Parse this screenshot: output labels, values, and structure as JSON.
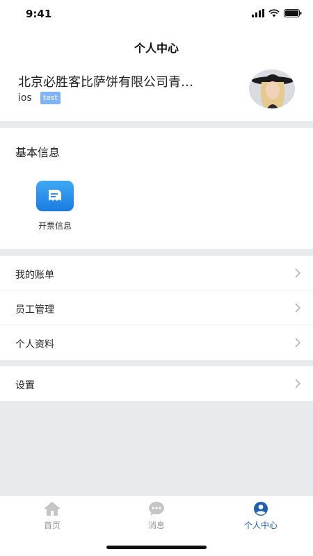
{
  "status_bar": {
    "time": "9:41"
  },
  "header": {
    "title": "个人中心"
  },
  "profile": {
    "company": "北京必胜客比萨饼有限公司青…",
    "username": "ios",
    "tag": "test"
  },
  "basic_info": {
    "title": "基本信息",
    "items": [
      {
        "label": "开票信息",
        "icon": "invoice-icon"
      }
    ]
  },
  "menu": {
    "group1": [
      {
        "label": "我的账单"
      },
      {
        "label": "员工管理"
      },
      {
        "label": "个人资料"
      }
    ],
    "group2": [
      {
        "label": "设置"
      }
    ]
  },
  "tabs": [
    {
      "label": "首页",
      "icon": "home-icon",
      "active": false
    },
    {
      "label": "消息",
      "icon": "chat-icon",
      "active": false
    },
    {
      "label": "个人中心",
      "icon": "user-icon",
      "active": true
    }
  ],
  "colors": {
    "active_tab": "#1e5fb0",
    "inactive_tab": "#999999",
    "tag_bg": "#7fb3f5",
    "invoice_icon": "#2a8ff0"
  }
}
